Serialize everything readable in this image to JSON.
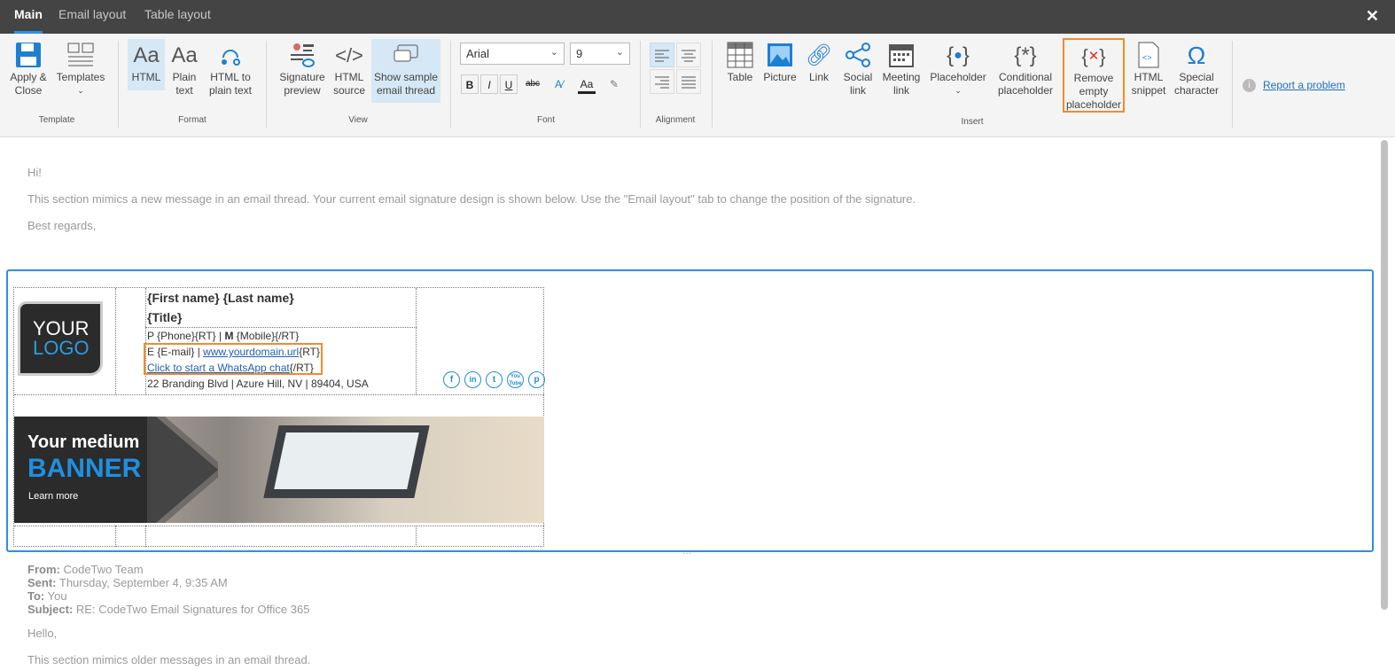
{
  "tabs": [
    "Main",
    "Email layout",
    "Table layout"
  ],
  "ribbon": {
    "apply_close": "Apply &\nClose",
    "templates": "Templates",
    "group_template": "Template",
    "html": "HTML",
    "plain_text": "Plain\ntext",
    "html_to_plain": "HTML to\nplain text",
    "group_format": "Format",
    "signature_preview": "Signature\npreview",
    "html_source": "HTML\nsource",
    "show_thread": "Show sample\nemail thread",
    "group_view": "View",
    "font_name": "Arial",
    "font_size": "9",
    "group_font": "Font",
    "group_alignment": "Alignment",
    "table": "Table",
    "picture": "Picture",
    "link": "Link",
    "social_link": "Social\nlink",
    "meeting_link": "Meeting\nlink",
    "placeholder": "Placeholder",
    "conditional": "Conditional\nplaceholder",
    "remove_empty": "Remove\nempty\nplaceholder",
    "html_snippet": "HTML\nsnippet",
    "special_char": "Special\ncharacter",
    "group_insert": "Insert",
    "report": "Report a problem"
  },
  "email_top": {
    "greeting": "Hi!",
    "body": "This section mimics a new message in an email thread. Your current email signature design is shown below. Use the \"Email layout\" tab to change the position of the signature.",
    "regards": "Best regards,"
  },
  "signature": {
    "logo_line1": "YOUR",
    "logo_line2": "LOGO",
    "name": "{First name} {Last name}",
    "title": "{Title}",
    "phone_prefix": "P",
    "phone": "{Phone}{RT} |",
    "mobile_prefix": "M",
    "mobile": "{Mobile}{/RT}",
    "email_line": "E {E-mail} |",
    "website": "www.yourdomain.url",
    "website_rt": "{RT}",
    "whatsapp": "Click to start a WhatsApp chat",
    "whatsapp_rt": "{/RT}",
    "address": "22 Branding Blvd | Azure Hill, NV | 89404, USA",
    "banner_line1": "Your medium",
    "banner_line2": "BANNER",
    "banner_cta": "Learn more",
    "social": [
      "f",
      "in",
      "t",
      "You Tube",
      "p"
    ]
  },
  "email_bottom": {
    "from_label": "From:",
    "from": "CodeTwo Team",
    "sent_label": "Sent:",
    "sent": "Thursday, September 4, 9:35 AM",
    "to_label": "To:",
    "to": "You",
    "subject_label": "Subject:",
    "subject": "RE: CodeTwo Email Signatures for Office 365",
    "hello": "Hello,",
    "body": "This section mimics older messages in an email thread."
  },
  "colors": {
    "accent": "#2f8fe0",
    "highlight": "#f28c28",
    "topbar": "#444444"
  }
}
